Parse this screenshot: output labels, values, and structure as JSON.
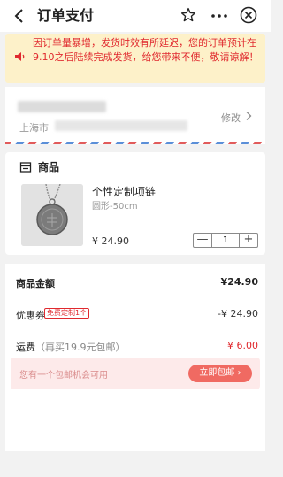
{
  "nav": {
    "title": "订单支付"
  },
  "notice": {
    "text": "因订单量暴增，发货时效有所延迟，您的订单预计在9.10之后陆续完成发货，给您带来不便，敬请谅解！"
  },
  "address": {
    "city": "上海市",
    "edit_label": "修改"
  },
  "goods": {
    "section_title": "商品",
    "name": "个性定制项链",
    "spec": "圆形-50cm",
    "price": "¥ 24.90",
    "quantity": "1",
    "minus": "—",
    "plus": "+"
  },
  "summary": {
    "amount_label": "商品金额",
    "amount_value": "¥24.90",
    "coupon_label": "优惠券",
    "coupon_tag": "免费定制1个",
    "coupon_value": "-¥ 24.90",
    "shipping_label": "运费",
    "shipping_note": "（再买19.9元包邮）",
    "shipping_value": "¥ 6.00",
    "banner_text": "您有一个包邮机会可用",
    "banner_button": "立即包邮 ›"
  },
  "colors": {
    "accent": "#e0292e",
    "notice_bg": "#fdf1c9",
    "banner_btn": "#f06a62"
  }
}
